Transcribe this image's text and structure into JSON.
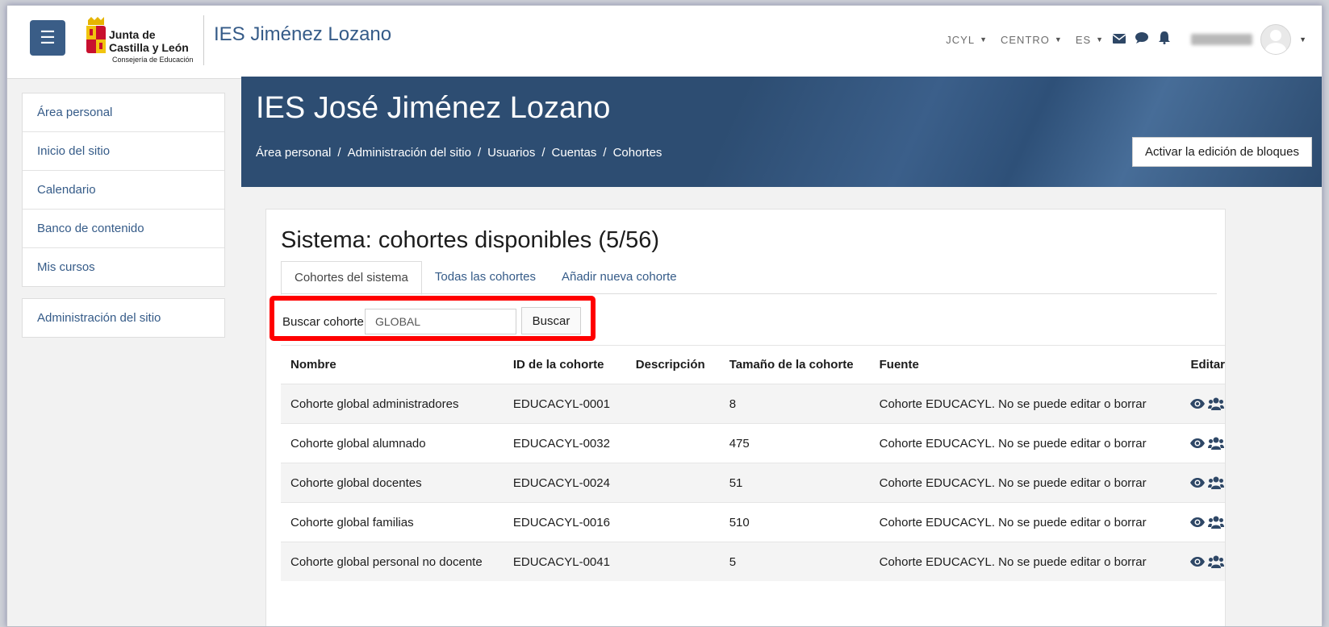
{
  "navbar": {
    "menu_icon": "hamburger-icon",
    "logo": {
      "line1": "Junta de",
      "line2": "Castilla y León",
      "line3": "Consejería de Educación"
    },
    "site_name": "IES Jiménez Lozano",
    "menus": [
      {
        "label": "JCYL"
      },
      {
        "label": "CENTRO"
      },
      {
        "label": "ES"
      }
    ],
    "icons": [
      "envelope-icon",
      "chat-icon",
      "bell-icon"
    ]
  },
  "sidebar": {
    "items": [
      {
        "label": "Área personal"
      },
      {
        "label": "Inicio del sitio"
      },
      {
        "label": "Calendario"
      },
      {
        "label": "Banco de contenido"
      },
      {
        "label": "Mis cursos"
      }
    ],
    "admin": {
      "label": "Administración del sitio"
    }
  },
  "header": {
    "title": "IES José Jiménez Lozano",
    "breadcrumb": [
      "Área personal",
      "Administración del sitio",
      "Usuarios",
      "Cuentas",
      "Cohortes"
    ],
    "separator": "/",
    "edit_blocks_label": "Activar la edición de bloques"
  },
  "main": {
    "heading": "Sistema: cohortes disponibles (5/56)",
    "tabs": [
      {
        "label": "Cohortes del sistema",
        "active": true
      },
      {
        "label": "Todas las cohortes",
        "active": false
      },
      {
        "label": "Añadir nueva cohorte",
        "active": false
      }
    ],
    "search": {
      "label": "Buscar cohorte",
      "value": "GLOBAL",
      "button": "Buscar"
    },
    "table": {
      "columns": [
        "Nombre",
        "ID de la cohorte",
        "Descripción",
        "Tamaño de la cohorte",
        "Fuente",
        "Editar"
      ],
      "rows": [
        {
          "name": "Cohorte global administradores",
          "id": "EDUCACYL-0001",
          "description": "",
          "size": "8",
          "source": "Cohorte EDUCACYL. No se puede editar o borrar"
        },
        {
          "name": "Cohorte global alumnado",
          "id": "EDUCACYL-0032",
          "description": "",
          "size": "475",
          "source": "Cohorte EDUCACYL. No se puede editar o borrar"
        },
        {
          "name": "Cohorte global docentes",
          "id": "EDUCACYL-0024",
          "description": "",
          "size": "51",
          "source": "Cohorte EDUCACYL. No se puede editar o borrar"
        },
        {
          "name": "Cohorte global familias",
          "id": "EDUCACYL-0016",
          "description": "",
          "size": "510",
          "source": "Cohorte EDUCACYL. No se puede editar o borrar"
        },
        {
          "name": "Cohorte global personal no docente",
          "id": "EDUCACYL-0041",
          "description": "",
          "size": "5",
          "source": "Cohorte EDUCACYL. No se puede editar o borrar"
        }
      ]
    }
  },
  "colors": {
    "link": "#355b88",
    "banner": "#2d4d72",
    "highlight": "#ff0000",
    "icon": "#2e4766"
  }
}
